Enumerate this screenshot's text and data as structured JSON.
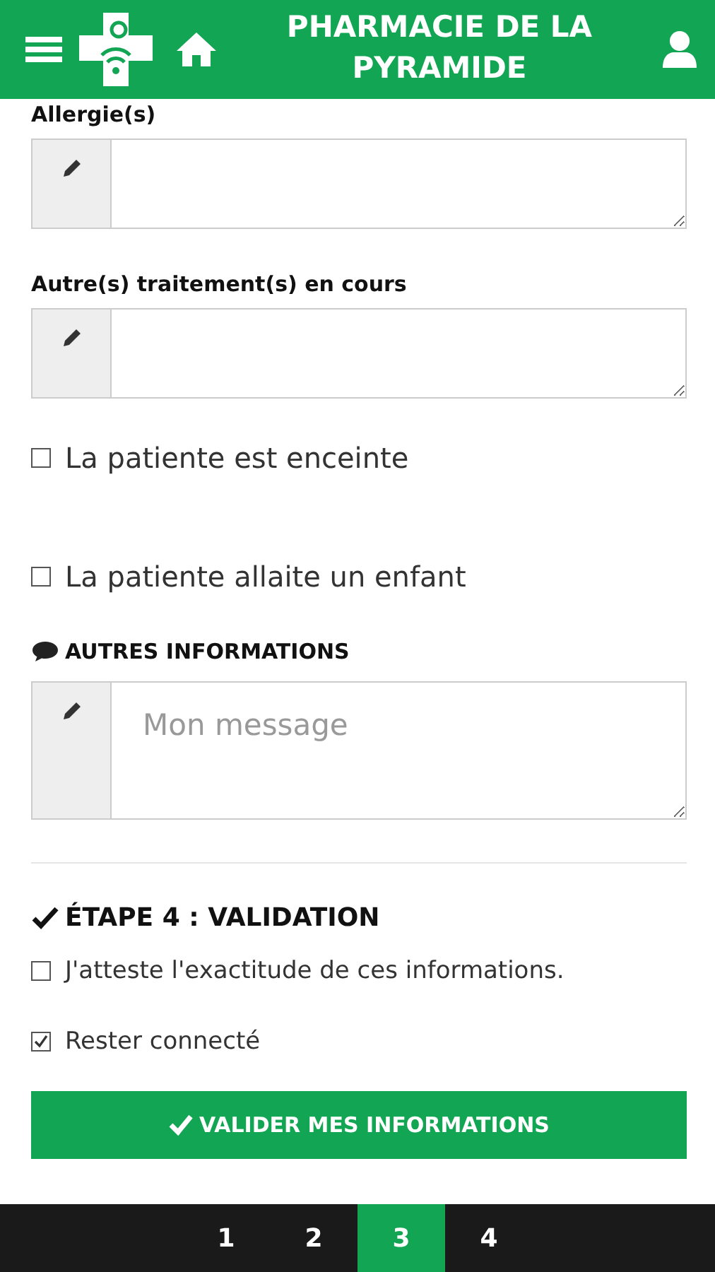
{
  "header": {
    "title": "PHARMACIE DE LA PYRAMIDE"
  },
  "fields": [
    {
      "label": "Allergie(s)"
    },
    {
      "label": "Autre(s) traitement(s) en cours"
    }
  ],
  "checkboxes": [
    {
      "label": "La patiente est enceinte",
      "checked": false
    },
    {
      "label": "La patiente allaite un enfant",
      "checked": false
    }
  ],
  "other_info": {
    "heading": "AUTRES INFORMATIONS",
    "placeholder": "Mon message"
  },
  "validation": {
    "heading": "ÉTAPE 4 : VALIDATION",
    "checkboxes": [
      {
        "label": "J'atteste l'exactitude de ces informations.",
        "checked": false
      },
      {
        "label": "Rester connecté",
        "checked": true
      }
    ],
    "button": "VALIDER MES INFORMATIONS"
  },
  "pager": [
    {
      "label": "1",
      "selected": false
    },
    {
      "label": "2",
      "selected": false
    },
    {
      "label": "3",
      "selected": true
    },
    {
      "label": "4",
      "selected": false
    }
  ]
}
